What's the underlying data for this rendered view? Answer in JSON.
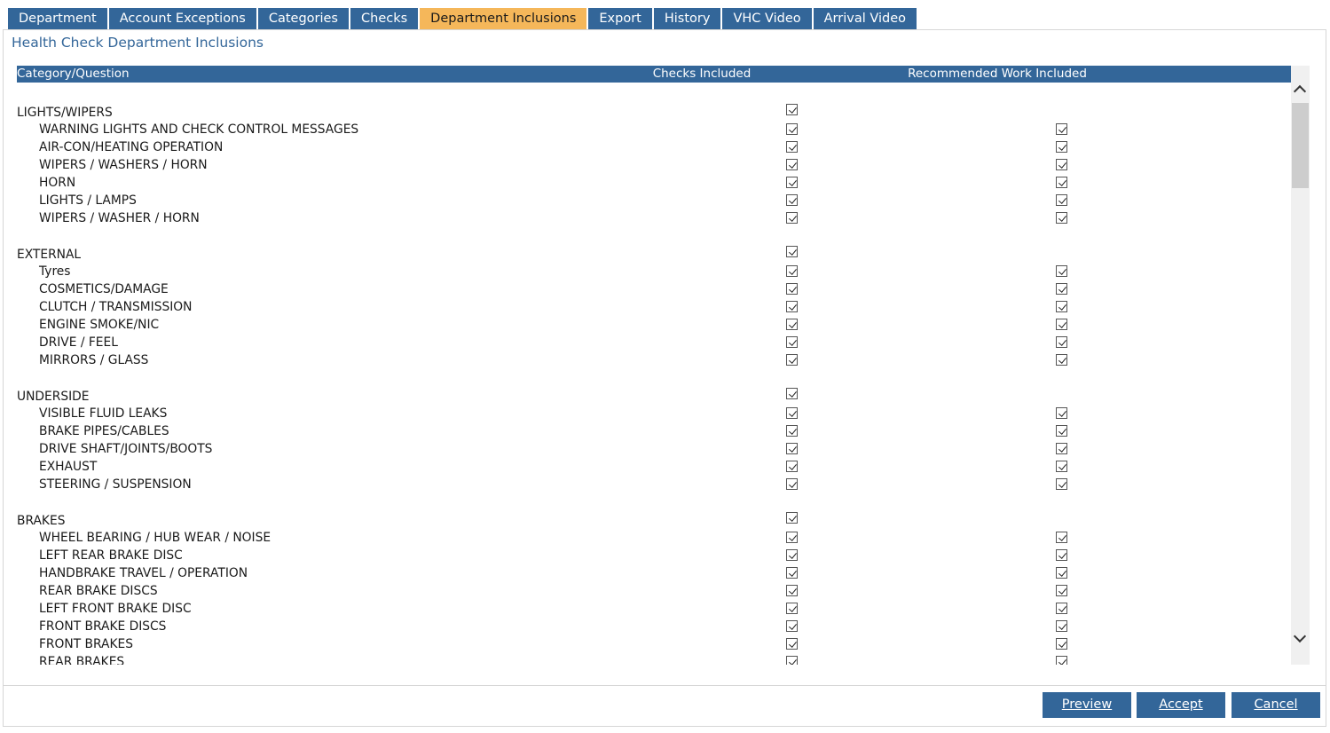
{
  "tabs": [
    {
      "label": "Department",
      "active": false
    },
    {
      "label": "Account Exceptions",
      "active": false
    },
    {
      "label": "Categories",
      "active": false
    },
    {
      "label": "Checks",
      "active": false
    },
    {
      "label": "Department Inclusions",
      "active": true
    },
    {
      "label": "Export",
      "active": false
    },
    {
      "label": "History",
      "active": false
    },
    {
      "label": "VHC Video",
      "active": false
    },
    {
      "label": "Arrival Video",
      "active": false
    }
  ],
  "page_title": "Health Check Department Inclusions",
  "table": {
    "headers": {
      "category_question": "Category/Question",
      "checks_included": "Checks Included",
      "recommended_work_included": "Recommended Work Included"
    },
    "groups": [
      {
        "category": "LIGHTS/WIPERS",
        "checks_included": true,
        "questions": [
          {
            "label": "WARNING LIGHTS AND CHECK CONTROL MESSAGES",
            "checks_included": true,
            "recommended_work_included": true
          },
          {
            "label": "AIR-CON/HEATING OPERATION",
            "checks_included": true,
            "recommended_work_included": true
          },
          {
            "label": "WIPERS / WASHERS / HORN",
            "checks_included": true,
            "recommended_work_included": true
          },
          {
            "label": "HORN",
            "checks_included": true,
            "recommended_work_included": true
          },
          {
            "label": "LIGHTS / LAMPS",
            "checks_included": true,
            "recommended_work_included": true
          },
          {
            "label": "WIPERS / WASHER / HORN",
            "checks_included": true,
            "recommended_work_included": true
          }
        ]
      },
      {
        "category": "EXTERNAL",
        "checks_included": true,
        "questions": [
          {
            "label": "Tyres",
            "checks_included": true,
            "recommended_work_included": true
          },
          {
            "label": "COSMETICS/DAMAGE",
            "checks_included": true,
            "recommended_work_included": true
          },
          {
            "label": "CLUTCH / TRANSMISSION",
            "checks_included": true,
            "recommended_work_included": true
          },
          {
            "label": "ENGINE SMOKE/NIC",
            "checks_included": true,
            "recommended_work_included": true
          },
          {
            "label": "DRIVE / FEEL",
            "checks_included": true,
            "recommended_work_included": true
          },
          {
            "label": "MIRRORS / GLASS",
            "checks_included": true,
            "recommended_work_included": true
          }
        ]
      },
      {
        "category": "UNDERSIDE",
        "checks_included": true,
        "questions": [
          {
            "label": "VISIBLE FLUID LEAKS",
            "checks_included": true,
            "recommended_work_included": true
          },
          {
            "label": "BRAKE PIPES/CABLES",
            "checks_included": true,
            "recommended_work_included": true
          },
          {
            "label": "DRIVE SHAFT/JOINTS/BOOTS",
            "checks_included": true,
            "recommended_work_included": true
          },
          {
            "label": "EXHAUST",
            "checks_included": true,
            "recommended_work_included": true
          },
          {
            "label": "STEERING / SUSPENSION",
            "checks_included": true,
            "recommended_work_included": true
          }
        ]
      },
      {
        "category": "BRAKES",
        "checks_included": true,
        "questions": [
          {
            "label": "WHEEL BEARING / HUB WEAR / NOISE",
            "checks_included": true,
            "recommended_work_included": true
          },
          {
            "label": "LEFT REAR BRAKE DISC",
            "checks_included": true,
            "recommended_work_included": true
          },
          {
            "label": "HANDBRAKE TRAVEL / OPERATION",
            "checks_included": true,
            "recommended_work_included": true
          },
          {
            "label": "REAR BRAKE DISCS",
            "checks_included": true,
            "recommended_work_included": true
          },
          {
            "label": "LEFT FRONT BRAKE DISC",
            "checks_included": true,
            "recommended_work_included": true
          },
          {
            "label": "FRONT BRAKE DISCS",
            "checks_included": true,
            "recommended_work_included": true
          },
          {
            "label": "FRONT BRAKES",
            "checks_included": true,
            "recommended_work_included": true
          },
          {
            "label": "REAR BRAKES",
            "checks_included": true,
            "recommended_work_included": true
          }
        ]
      }
    ]
  },
  "buttons": {
    "preview": "Preview",
    "accept": "Accept",
    "cancel": "Cancel"
  },
  "icons": {
    "scroll_up": "chevron-up-icon",
    "scroll_down": "chevron-down-icon",
    "checkbox": "checkbox-checked-icon"
  },
  "colors": {
    "tab_bg": "#336699",
    "tab_active_bg": "#f5b75a",
    "header_bg": "#336699",
    "title_text": "#336699",
    "button_bg": "#336699"
  }
}
